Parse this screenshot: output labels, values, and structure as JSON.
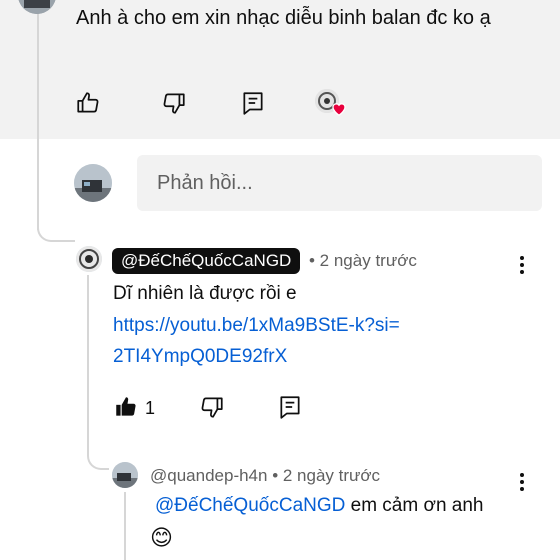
{
  "parent_comment": {
    "text": "Anh à cho em xin nhạc diễu binh balan đc ko ạ",
    "actions": {
      "like_icon": "thumb-up-outline-icon",
      "dislike_icon": "thumb-down-outline-icon",
      "reply_icon": "reply-comment-icon",
      "creator_heart_icon": "creator-heart-icon"
    }
  },
  "reply_box": {
    "placeholder": "Phản hồi..."
  },
  "replies": [
    {
      "handle": "@ĐếChếQuốcCaNGD",
      "time": "• 2 ngày trước",
      "text": "Dĩ nhiên là được rồi e",
      "link_line1": "https://youtu.be/1xMa9BStE-k?si=",
      "link_line2": "2TI4YmpQ0DE92frX",
      "like_count": "1",
      "is_creator": true
    },
    {
      "handle": "@quandep-h4n",
      "time": "• 2 ngày trước",
      "mention": "@ĐếChếQuốcCaNGD",
      "text": " em cảm ơn anh",
      "emoji": "😊"
    }
  ],
  "colors": {
    "link": "#065fd4",
    "highlight_bg": "#f2f2f2",
    "heart": "#e8003d",
    "creator_pill_bg": "#0f0f0f"
  }
}
